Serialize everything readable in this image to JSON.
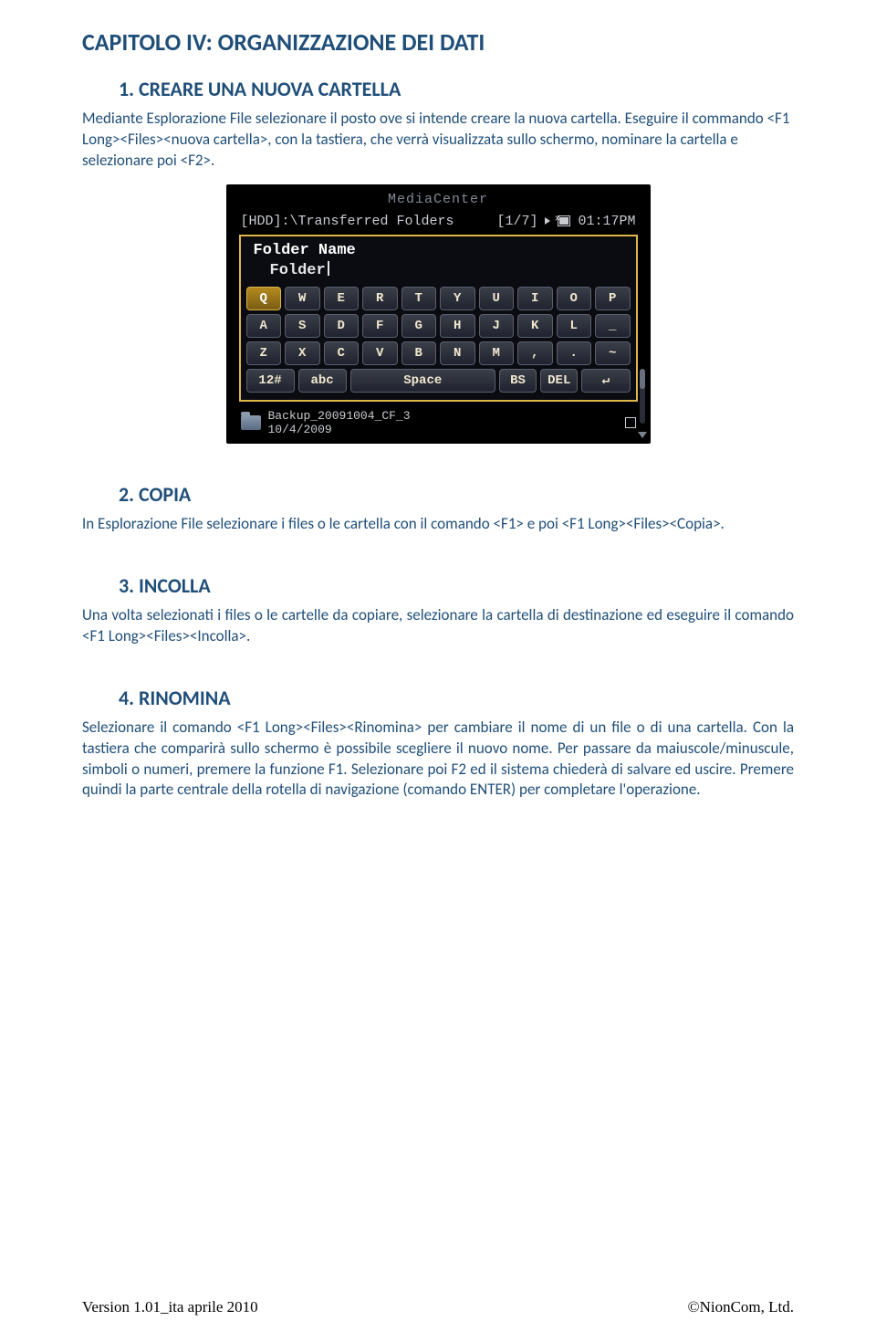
{
  "chapter_title": "CAPITOLO IV: ORGANIZZAZIONE DEI DATI",
  "sections": {
    "s1": {
      "heading": "1.   CREARE UNA NUOVA CARTELLA",
      "p1": "Mediante Esplorazione File selezionare il posto ove si intende creare la nuova cartella. Eseguire il commando <F1 Long><Files><nuova cartella>, con la tastiera, che verrà visualizzata sullo schermo, nominare la cartella e selezionare poi <F2>."
    },
    "s2": {
      "heading": "2.   COPIA",
      "p1": "In Esplorazione File selezionare i files o le cartella con il comando <F1> e poi <F1 Long><Files><Copia>."
    },
    "s3": {
      "heading": "3.   INCOLLA",
      "p1": "Una volta selezionati i files o le cartelle da copiare, selezionare la cartella di destinazione ed eseguire il comando <F1 Long><Files><Incolla>."
    },
    "s4": {
      "heading": "4.   RINOMINA",
      "p1": "Selezionare il comando <F1 Long><Files><Rinomina> per cambiare il nome di un file o di una cartella. Con la tastiera che comparirà sullo schermo è possibile scegliere il nuovo nome. Per passare da maiuscole/minuscule, simboli o numeri, premere la funzione F1. Selezionare poi F2 ed il sistema chiederà di salvare ed uscire. Premere quindi la parte centrale della rotella di navigazione (comando ENTER) per completare l'operazione."
    }
  },
  "screenshot": {
    "app_title": "MediaCenter",
    "path": "[HDD]:\\Transferred Folders",
    "page_indicator": "[1/7]",
    "clock": "01:17PM",
    "folder_label": "Folder Name",
    "folder_value": "Folder",
    "keyboard": {
      "row1": [
        "Q",
        "W",
        "E",
        "R",
        "T",
        "Y",
        "U",
        "I",
        "O",
        "P"
      ],
      "row2": [
        "A",
        "S",
        "D",
        "F",
        "G",
        "H",
        "J",
        "K",
        "L",
        "_"
      ],
      "row3": [
        "Z",
        "X",
        "C",
        "V",
        "B",
        "N",
        "M",
        ",",
        ".",
        "~"
      ],
      "row4": [
        "12#",
        "abc",
        "Space",
        "BS",
        "DEL",
        "↵"
      ]
    },
    "footer_filename": "Backup_20091004_CF_3",
    "footer_date": "10/4/2009"
  },
  "footer": {
    "left": "Version 1.01_ita aprile 2010",
    "right": "©NionCom, Ltd."
  }
}
